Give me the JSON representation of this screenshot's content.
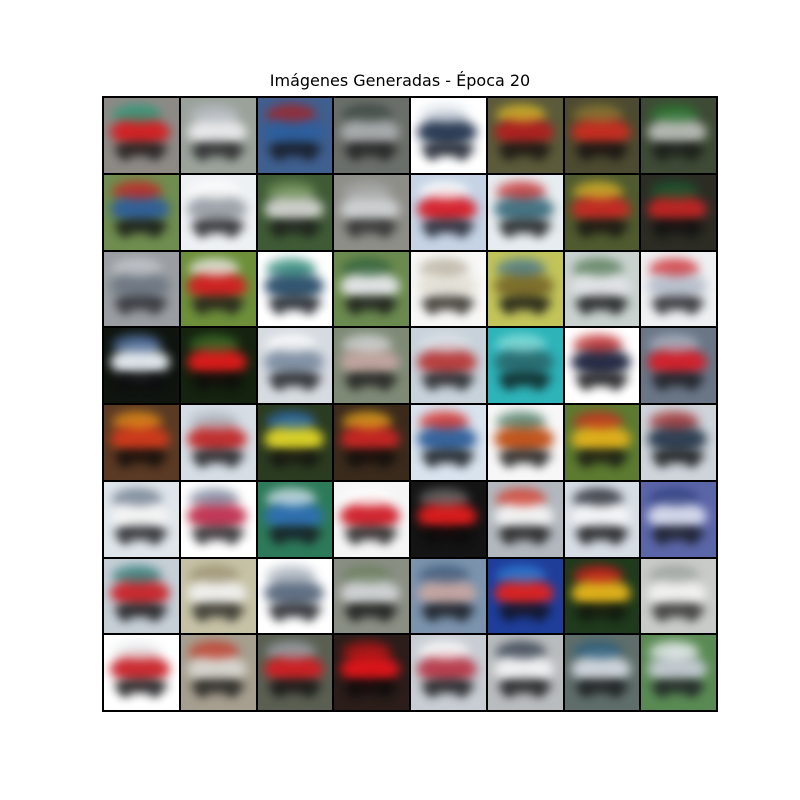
{
  "figure": {
    "title": "Imágenes Generadas - Época 20"
  },
  "grid": {
    "rows": 8,
    "cols": 8,
    "tiles": [
      {
        "bg": "#8d8a86",
        "main": "#d41f22",
        "accent": "#2b9a7a",
        "dark": "#1b1616"
      },
      {
        "bg": "#9aa29a",
        "main": "#e9eaec",
        "accent": "#b8bdc4",
        "dark": "#202022"
      },
      {
        "bg": "#3f5f8f",
        "main": "#2d5f9e",
        "accent": "#a82323",
        "dark": "#141820"
      },
      {
        "bg": "#6b6f6a",
        "main": "#a9adae",
        "accent": "#3a4640",
        "dark": "#1a1c1c"
      },
      {
        "bg": "#ffffff",
        "main": "#243650",
        "accent": "#d8dee6",
        "dark": "#0f1522"
      },
      {
        "bg": "#5b5a3a",
        "main": "#b02020",
        "accent": "#d9b92b",
        "dark": "#161210"
      },
      {
        "bg": "#4c4a30",
        "main": "#c92d21",
        "accent": "#8c7a32",
        "dark": "#141010"
      },
      {
        "bg": "#3e4a35",
        "main": "#b8bcb6",
        "accent": "#2e7a34",
        "dark": "#141815"
      },
      {
        "bg": "#6f8d4f",
        "main": "#2f5f9a",
        "accent": "#c82424",
        "dark": "#141414"
      },
      {
        "bg": "#eef1f4",
        "main": "#9aa0a6",
        "accent": "#ffffff",
        "dark": "#1b1c20"
      },
      {
        "bg": "#3f5b35",
        "main": "#d2d3cf",
        "accent": "#7a9a62",
        "dark": "#181a18"
      },
      {
        "bg": "#8e8e88",
        "main": "#cfd2d4",
        "accent": "#a8aaa8",
        "dark": "#2a2a2a"
      },
      {
        "bg": "#c5d3e4",
        "main": "#d61f2a",
        "accent": "#ffffff",
        "dark": "#1b1e2a"
      },
      {
        "bg": "#e6ecef",
        "main": "#3f6f7f",
        "accent": "#c83232",
        "dark": "#151719"
      },
      {
        "bg": "#4f5a2f",
        "main": "#c62a24",
        "accent": "#d6b52a",
        "dark": "#141210"
      },
      {
        "bg": "#2c2c24",
        "main": "#c02524",
        "accent": "#1d5a30",
        "dark": "#0f0f0f"
      },
      {
        "bg": "#9a9ea2",
        "main": "#6f7883",
        "accent": "#c8ccd0",
        "dark": "#2a2c32"
      },
      {
        "bg": "#6d8f3a",
        "main": "#d21f22",
        "accent": "#f0f0ee",
        "dark": "#1e1c18"
      },
      {
        "bg": "#ffffff",
        "main": "#2b4f6b",
        "accent": "#2f8c7b",
        "dark": "#131820"
      },
      {
        "bg": "#6b8a4f",
        "main": "#e5e7ea",
        "accent": "#2f5f3a",
        "dark": "#161616"
      },
      {
        "bg": "#f7f7f5",
        "main": "#e3e0d6",
        "accent": "#b8b0a0",
        "dark": "#2a2620"
      },
      {
        "bg": "#c2c45a",
        "main": "#7b6b2a",
        "accent": "#4a7a8f",
        "dark": "#151513"
      },
      {
        "bg": "#c9d2cf",
        "main": "#e1e3e6",
        "accent": "#547a55",
        "dark": "#121314"
      },
      {
        "bg": "#eef0f2",
        "main": "#b8bfcc",
        "accent": "#d03035",
        "dark": "#1d1f24"
      },
      {
        "bg": "#0f140f",
        "main": "#e8eef4",
        "accent": "#5778a8",
        "dark": "#0c0d10"
      },
      {
        "bg": "#15220f",
        "main": "#e01c1c",
        "accent": "#3d6f2a",
        "dark": "#0b0c0b"
      },
      {
        "bg": "#d6dbe0",
        "main": "#7f8fa3",
        "accent": "#ffffff",
        "dark": "#1a1c20"
      },
      {
        "bg": "#7f8a76",
        "main": "#c2a6a0",
        "accent": "#d4d7d8",
        "dark": "#1b1b1b"
      },
      {
        "bg": "#c8d2da",
        "main": "#b83a3a",
        "accent": "#dfe4ea",
        "dark": "#1a1c20"
      },
      {
        "bg": "#2db3b8",
        "main": "#2a6b6f",
        "accent": "#8fe3de",
        "dark": "#102020"
      },
      {
        "bg": "#ffffff",
        "main": "#1e2540",
        "accent": "#c02a2a",
        "dark": "#0f0f12"
      },
      {
        "bg": "#6a7686",
        "main": "#d41f2a",
        "accent": "#aeb6c4",
        "dark": "#171a20"
      },
      {
        "bg": "#5a3a24",
        "main": "#d03a1c",
        "accent": "#e48c1a",
        "dark": "#100c0a"
      },
      {
        "bg": "#d6dde4",
        "main": "#c02a2a",
        "accent": "#aeb6bf",
        "dark": "#171a1d"
      },
      {
        "bg": "#2b3b20",
        "main": "#e0d628",
        "accent": "#2f6fb2",
        "dark": "#121210"
      },
      {
        "bg": "#3a2a1c",
        "main": "#c82624",
        "accent": "#e6a21c",
        "dark": "#0e0c0a"
      },
      {
        "bg": "#d8e3ee",
        "main": "#2f5f9a",
        "accent": "#d52a24",
        "dark": "#101418"
      },
      {
        "bg": "#f7f7f7",
        "main": "#c04f16",
        "accent": "#4f7f6a",
        "dark": "#151515"
      },
      {
        "bg": "#5c7a30",
        "main": "#e2b21c",
        "accent": "#c83221",
        "dark": "#141412"
      },
      {
        "bg": "#ced4da",
        "main": "#2a3b4f",
        "accent": "#a13030",
        "dark": "#0f1113"
      },
      {
        "bg": "#dfe5ea",
        "main": "#f4f4f4",
        "accent": "#6c7a8c",
        "dark": "#1a1b1f"
      },
      {
        "bg": "#ffffff",
        "main": "#c0304f",
        "accent": "#7f8aa0",
        "dark": "#1f1f22"
      },
      {
        "bg": "#2d7a5a",
        "main": "#2f6fb2",
        "accent": "#d7e6f0",
        "dark": "#141820"
      },
      {
        "bg": "#f5f5f5",
        "main": "#d01e28",
        "accent": "#ffffff",
        "dark": "#1a1a1a"
      },
      {
        "bg": "#141414",
        "main": "#e01d1d",
        "accent": "#6f6f6f",
        "dark": "#0a0a0a"
      },
      {
        "bg": "#b2b8be",
        "main": "#f4f4f4",
        "accent": "#d53a2a",
        "dark": "#161616"
      },
      {
        "bg": "#d7dde4",
        "main": "#f4f6f8",
        "accent": "#1c2028",
        "dark": "#0f1012"
      },
      {
        "bg": "#5b66a8",
        "main": "#d8dced",
        "accent": "#2f3f7f",
        "dark": "#151820"
      },
      {
        "bg": "#c6ced6",
        "main": "#c8242a",
        "accent": "#2f7f7a",
        "dark": "#121416"
      },
      {
        "bg": "#c6c2a6",
        "main": "#f0f0ee",
        "accent": "#9a8f6f",
        "dark": "#2a2823"
      },
      {
        "bg": "#ffffff",
        "main": "#5a6a7f",
        "accent": "#aeb6c0",
        "dark": "#181b20"
      },
      {
        "bg": "#8a8f84",
        "main": "#d1d4d6",
        "accent": "#6b7f5f",
        "dark": "#131313"
      },
      {
        "bg": "#7b93ad",
        "main": "#c6a6a2",
        "accent": "#3f5a7a",
        "dark": "#12151a"
      },
      {
        "bg": "#1f3e9a",
        "main": "#e0231f",
        "accent": "#2f7fd6",
        "dark": "#0f1220"
      },
      {
        "bg": "#1f3a1c",
        "main": "#e6b51c",
        "accent": "#d11f1f",
        "dark": "#0f140d"
      },
      {
        "bg": "#c9cbc8",
        "main": "#f2f2f0",
        "accent": "#9aa09a",
        "dark": "#2a2a2a"
      },
      {
        "bg": "#ffffff",
        "main": "#c8242a",
        "accent": "#e6e8ea",
        "dark": "#0f1012"
      },
      {
        "bg": "#a69f8f",
        "main": "#d8d6d0",
        "accent": "#c33a2a",
        "dark": "#1d1c1a"
      },
      {
        "bg": "#5a5f52",
        "main": "#d01f24",
        "accent": "#9ea6ae",
        "dark": "#121212"
      },
      {
        "bg": "#2a1d1a",
        "main": "#e0151a",
        "accent": "#b51818",
        "dark": "#0c0a0a"
      },
      {
        "bg": "#c8cdd3",
        "main": "#b83a4a",
        "accent": "#ffffff",
        "dark": "#15171a"
      },
      {
        "bg": "#b9bcbe",
        "main": "#f2f3f4",
        "accent": "#2f3a4a",
        "dark": "#141516"
      },
      {
        "bg": "#5f6e6a",
        "main": "#d2d8df",
        "accent": "#2a5f7f",
        "dark": "#151618"
      },
      {
        "bg": "#5a8a54",
        "main": "#c4cad2",
        "accent": "#eef2f6",
        "dark": "#1a1c20"
      }
    ]
  }
}
